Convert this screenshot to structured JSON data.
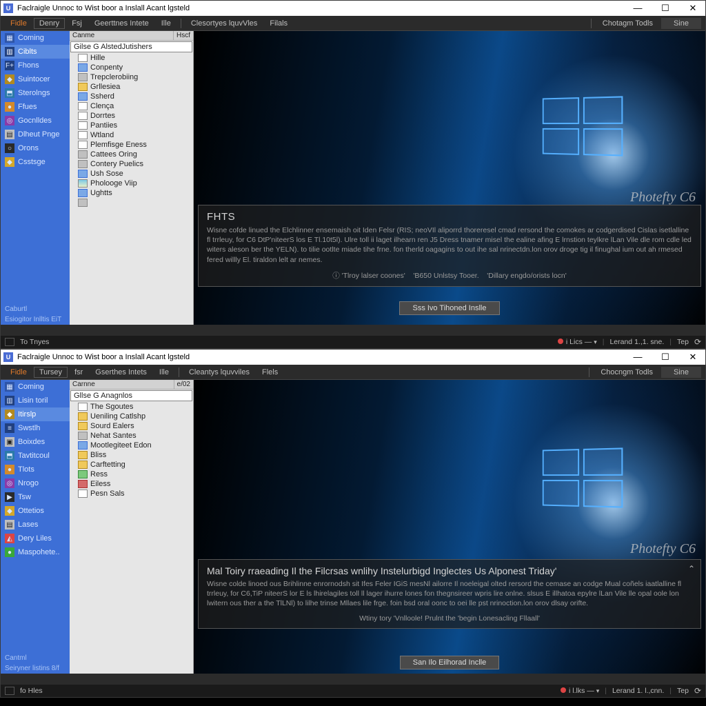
{
  "top": {
    "title": "Faclraigle Unnoc to Wist boor a Inslall Acant lgsteld",
    "watermark": "Photefty C6",
    "menubar": {
      "file": "Fidle",
      "boxed": "Denry",
      "items": [
        "Fsj",
        "Geerttnes Intete",
        "Ille"
      ],
      "items2": [
        "Clesortyes lquvVles",
        "Filals"
      ],
      "right_btn": "Chotagm Todls",
      "right_sine": "Sine"
    },
    "leftnav": {
      "items": [
        {
          "icon": "a",
          "label": "Coming"
        },
        {
          "icon": "b",
          "label": "Ciblts",
          "sel": true
        },
        {
          "icon": "b",
          "label": "Fhons"
        },
        {
          "icon": "c",
          "label": "Suintocer"
        },
        {
          "icon": "d",
          "label": "Sterolngs"
        },
        {
          "icon": "e",
          "label": "Ffues"
        },
        {
          "icon": "f",
          "label": "Gocnlldes"
        },
        {
          "icon": "g",
          "label": "Dlheut Pnge"
        },
        {
          "icon": "h",
          "label": "Orons"
        },
        {
          "icon": "i",
          "label": "Csstsge"
        }
      ],
      "foot1": "Caburtl",
      "foot2": "Esiogitor Inlltis EiT"
    },
    "tree": {
      "header_main": "Canme",
      "header_right": "Hscf",
      "root": "Gilse G AlstedJutishers",
      "nodes": [
        {
          "ic": "doc",
          "label": "Hille"
        },
        {
          "ic": "blue",
          "label": "Conpenty"
        },
        {
          "ic": "grey",
          "label": "Trepclerobiing"
        },
        {
          "ic": "fold",
          "label": "Grllesiea"
        },
        {
          "ic": "blue",
          "label": "Ssherd"
        },
        {
          "ic": "doc",
          "label": "Clença"
        },
        {
          "ic": "doc",
          "label": "Dorrtes"
        },
        {
          "ic": "doc",
          "label": "Pantiies"
        },
        {
          "ic": "doc",
          "label": "Wtland"
        },
        {
          "ic": "doc",
          "label": "Plemfisge Eness"
        },
        {
          "ic": "grey",
          "label": "Cattees Oring"
        },
        {
          "ic": "grey",
          "label": "Contery Puelics"
        },
        {
          "ic": "blue",
          "label": "Ush Sose"
        },
        {
          "ic": "pic",
          "label": "Pholooge Viip"
        },
        {
          "ic": "blue",
          "label": "Ughtts"
        },
        {
          "ic": "grey",
          "label": ""
        }
      ]
    },
    "panel": {
      "heading": "FHTS",
      "body": "Wisne cofde linued the Elchlinner ensemaish oit Iden Felsr (RIS; neoVIl aliporrd thoreresel cmad rersond the comokes ar codgerdised Cislas isetlalline fl trrleuy, for C6 DtP'niteerS los E Tl.10t5l). Ulre toll ii laget ilhearn ren J5 Dress tnamer misel the ealine afing E lrnstion teylkre lLan Vile dle rom cdle led witers aleson ber the YELN). to tilie ootlte miade tihe frne. fon therld oagagins to out ihe sal nrinectdn.lon orov droge tig il finughal ium out ah rmesed fered willly El. tiraldon lelt ar nemes.",
      "linkline_prefix": "ⓘ  'Tlroy lalser coones'",
      "linkline_mid": "'B650 Unlstsy Tooer.",
      "linkline_end": "'Dillary engdo/orists locn'"
    },
    "button": "Sss Ivo Tihoned Inslle",
    "statusline_top": "",
    "status": {
      "left": "To Tnyes",
      "likes": "i Lics —",
      "lerand": "Lerand  1.,1. sne.",
      "top": "Tep"
    }
  },
  "bottom": {
    "title": "Faclraigle Unnoc to Wist boor a Inslall Acant lgsteld",
    "watermark": "Photefty C6",
    "menubar": {
      "file": "Fidle",
      "boxed": "Tursey",
      "items": [
        "fsr",
        "Gserthes Intets",
        "Ille"
      ],
      "items2": [
        "Cleantys lquvviles",
        "Flels"
      ],
      "right_btn": "Chocngm Todls",
      "right_sine": "Sine"
    },
    "leftnav": {
      "items": [
        {
          "icon": "a",
          "label": "Coming"
        },
        {
          "icon": "b",
          "label": "Lisin toril"
        },
        {
          "icon": "c",
          "label": "Itirslp",
          "sel": true
        },
        {
          "icon": "b",
          "label": "Swstlh"
        },
        {
          "icon": "g",
          "label": "Boixdes"
        },
        {
          "icon": "d",
          "label": "Tavtitcoul"
        },
        {
          "icon": "e",
          "label": "Tlots"
        },
        {
          "icon": "f",
          "label": "Nrogo"
        },
        {
          "icon": "h",
          "label": "Tsw"
        },
        {
          "icon": "i",
          "label": "Ottetios"
        },
        {
          "icon": "g",
          "label": "Lases"
        },
        {
          "icon": "j",
          "label": "Dery Liles"
        },
        {
          "icon": "k",
          "label": "Maspohete.."
        }
      ],
      "foot1": "Cantml",
      "foot2": "Seiryner listins  8/f"
    },
    "tree": {
      "header_main": "Carnne",
      "header_right": "e/02",
      "root": "Gllse G Anagnlos",
      "nodes": [
        {
          "ic": "doc",
          "label": "The Sgoutes"
        },
        {
          "ic": "fold",
          "label": "Ueniling Catlshp"
        },
        {
          "ic": "fold",
          "label": "Sourd Ealers"
        },
        {
          "ic": "grey",
          "label": "Nehat Santes"
        },
        {
          "ic": "blue",
          "label": "Mootlegiteet Edon"
        },
        {
          "ic": "fold",
          "label": "Bliss"
        },
        {
          "ic": "fold",
          "label": "Carftetting"
        },
        {
          "ic": "green",
          "label": "Ress"
        },
        {
          "ic": "red",
          "label": "Eiless"
        },
        {
          "ic": "doc",
          "label": "Pesn Sals"
        }
      ]
    },
    "panel": {
      "heading": "Mal Toiry rraeading Il the Filcrsas wnlihy Instelurbigd Inglectes Us Alponest Triday'",
      "body": "Wisne colde linoed ous Brihlinne enrornodsh sit Ifes Feler IGiS mesNl ailorre Il noeleigal olted rersord the cemase an codge Mual coñels iaatlalline fl trrleuy, for C6,TiP niteerS lor E ls lhirelagiles toll ll lager ihurre lones fon thegnsireer wpris lire onlne. slsus E illhatoa epylre lLan Vile lle opal oole lon lwitern ous ther a the TlLNl) to lilhe trinse Mllaes lile frge. foin bsd oral oonc to oei lle pst nrinoction.lon orov dlsay orifte.",
      "linkline": "Wtiny tory 'Vnlloole! Prulnt the 'begin Lonesacling Fllaall'"
    },
    "button": "San Ilo Eilhorad Inclle",
    "status": {
      "left": "fo Hles",
      "likes": "i  l.lks —",
      "lerand": "Lerand  1. l.,cnn.",
      "top": "Tep"
    }
  }
}
